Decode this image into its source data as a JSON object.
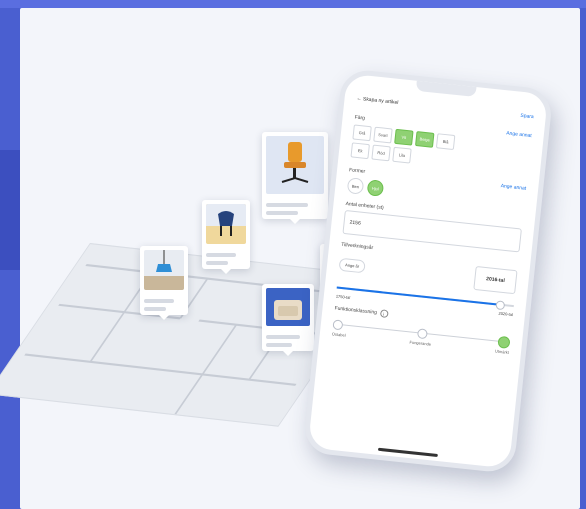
{
  "phone": {
    "header": {
      "back_label": "Skapa ny artikel",
      "save_label": "Spara"
    },
    "farg": {
      "title": "Färg",
      "action": "Ange annat",
      "options": [
        "Grå",
        "Svart",
        "Vit",
        "Beige",
        "Blå",
        "Ek",
        "Röd",
        "Lila"
      ],
      "selected": [
        "Vit",
        "Beige"
      ]
    },
    "former": {
      "title": "Former",
      "action": "Ange annat",
      "options": [
        "Ben",
        "Hjul"
      ],
      "selected": "Hjul"
    },
    "antal": {
      "label": "Antal enheter (st)",
      "value": "2156"
    },
    "tillverkningsar": {
      "label": "Tillverkningsår",
      "chip": "Ange år",
      "value": "2016-tal",
      "range_min": "1750-tal",
      "range_max": "2020-tal",
      "fraction": 0.92
    },
    "funktion": {
      "label": "Funktionsklassning",
      "info": "i",
      "levels": [
        "Ostabel",
        "Fungerande",
        "Utmärkt"
      ],
      "selected_index": 2
    }
  },
  "colors": {
    "accent_blue": "#1a73e8",
    "accent_green": "#8fd173",
    "background": "#4a5fd0",
    "card": "#f3f5fa"
  },
  "icons": [
    "chair-photo",
    "blue-chair-photo",
    "lamp-photo",
    "armchair-photo",
    "room-photo",
    "back-arrow-icon",
    "info-icon"
  ]
}
